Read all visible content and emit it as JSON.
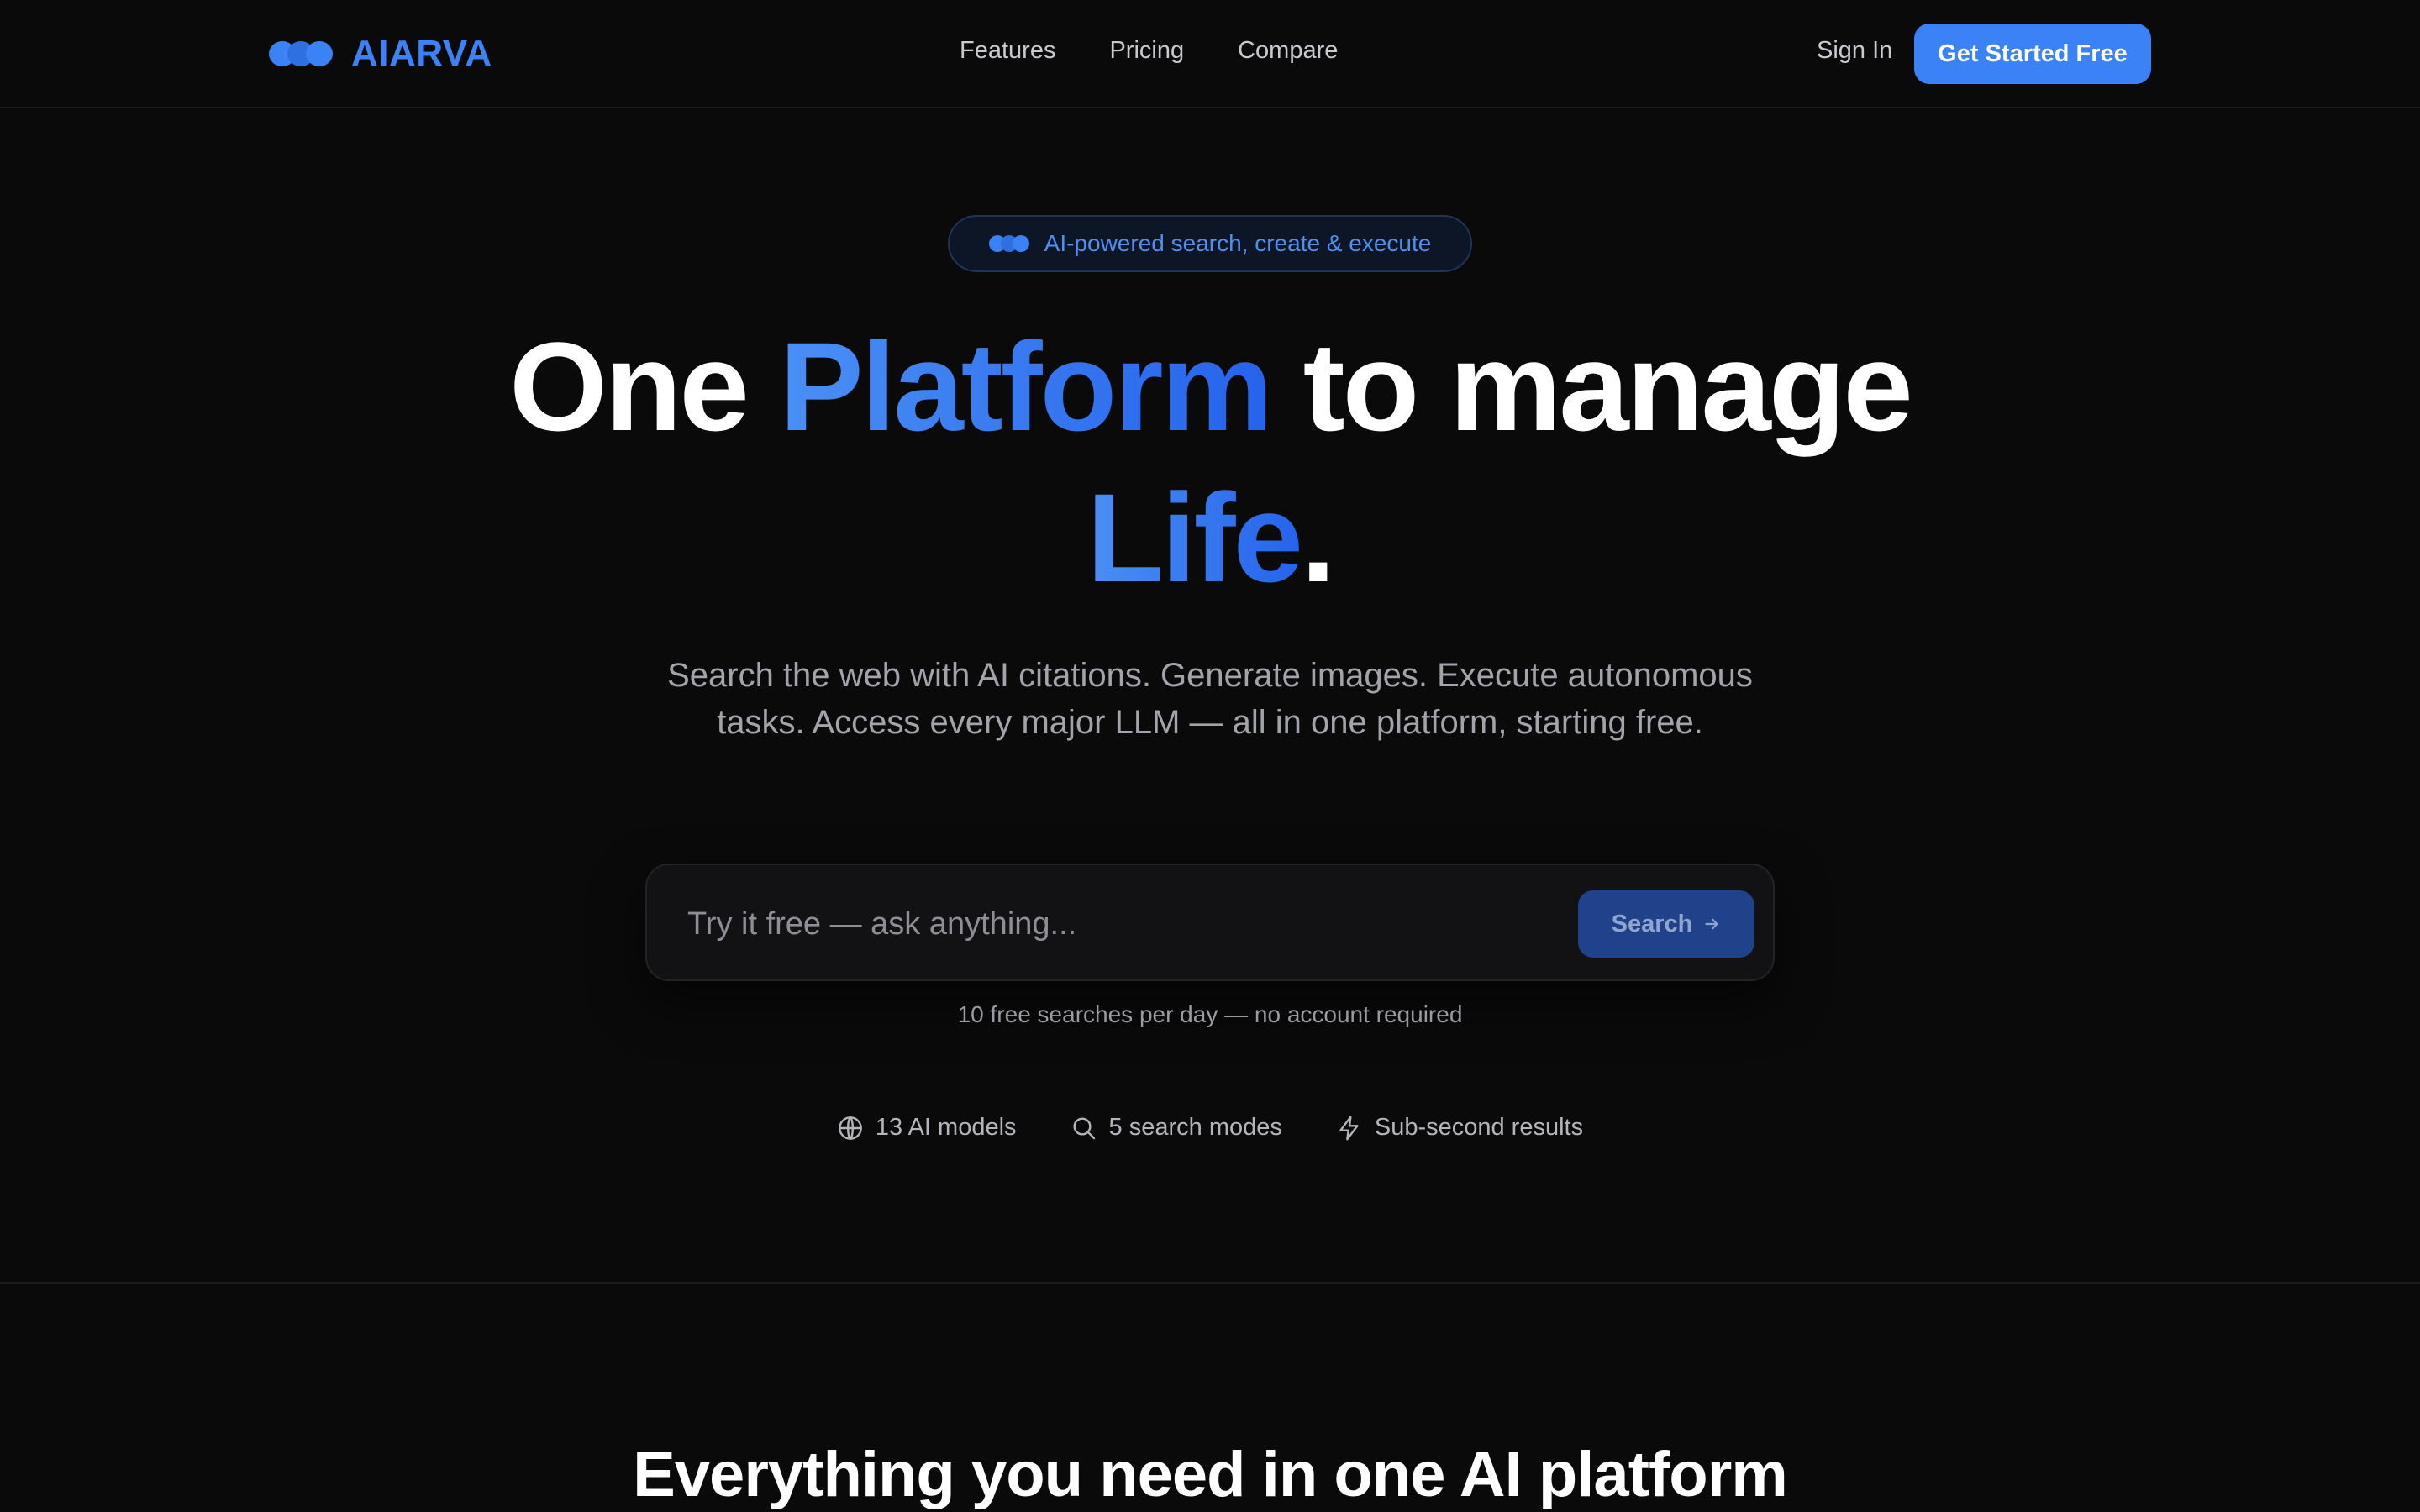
{
  "brand": {
    "name": "AIARVA",
    "color": "#3b82f6"
  },
  "nav": {
    "links": [
      {
        "label": "Features"
      },
      {
        "label": "Pricing"
      },
      {
        "label": "Compare"
      }
    ],
    "sign_in": "Sign In",
    "cta": "Get Started Free"
  },
  "hero": {
    "badge": "AI-powered search, create & execute",
    "headline": {
      "part1": "One ",
      "highlight1": "Platform",
      "part2": " to manage",
      "highlight2": "Life",
      "part3": "."
    },
    "subtitle": "Search the web with AI citations. Generate images. Execute autonomous tasks. Access every major LLM — all in one platform, starting free.",
    "search": {
      "placeholder": "Try it free — ask anything...",
      "button_label": "Search",
      "button_icon": "arrow-right-icon"
    },
    "note": "10 free searches per day — no account required",
    "features": [
      {
        "icon": "globe-icon",
        "label": "13 AI models"
      },
      {
        "icon": "search-icon",
        "label": "5 search modes"
      },
      {
        "icon": "lightning-icon",
        "label": "Sub-second results"
      }
    ]
  },
  "section": {
    "title": "Everything you need in one AI platform"
  },
  "colors": {
    "background": "#0a0a0a",
    "accent": "#3b82f6",
    "accent_dark": "#2563eb",
    "muted_text": "#a3a3ab"
  }
}
